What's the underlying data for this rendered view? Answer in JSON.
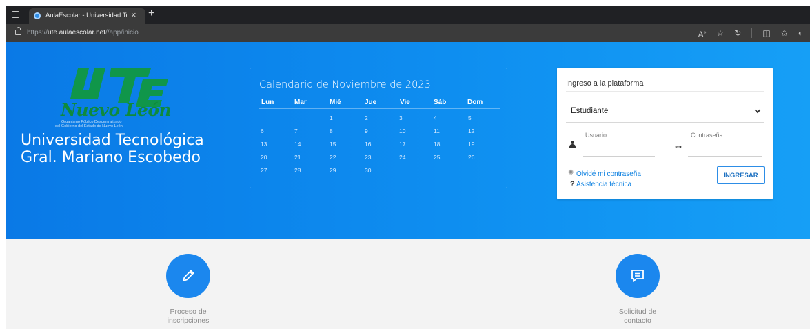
{
  "browser": {
    "tab_title": "AulaEscolar - Universidad Tecnológica",
    "tab_close": "×",
    "new_tab": "+",
    "url_prefix": "https://",
    "url_host": "ute.aulaescolar.net",
    "url_path": "//app/inicio",
    "icons": [
      "read-aloud-icon",
      "favorite-star-icon",
      "refresh-icon",
      "split-screen-icon",
      "favorites-icon",
      "copilot-icon"
    ]
  },
  "hero": {
    "logo_text": "Nuevo León",
    "logo_sub1": "Organismo Público Descentralizado",
    "logo_sub2": "del Gobierno del Estado de Nuevo León",
    "university_line1": "Universidad Tecnológica",
    "university_line2": "Gral. Mariano Escobedo",
    "gradient_start": "#0a79e6",
    "gradient_end": "#169ff6"
  },
  "calendar": {
    "title": "Calendario de Noviembre de 2023",
    "weekdays": [
      "Lun",
      "Mar",
      "Mié",
      "Jue",
      "Vie",
      "Sáb",
      "Dom"
    ],
    "weeks": [
      [
        "",
        "",
        "1",
        "2",
        "3",
        "4",
        "5"
      ],
      [
        "6",
        "7",
        "8",
        "9",
        "10",
        "11",
        "12"
      ],
      [
        "13",
        "14",
        "15",
        "16",
        "17",
        "18",
        "19"
      ],
      [
        "20",
        "21",
        "22",
        "23",
        "24",
        "25",
        "26"
      ],
      [
        "27",
        "28",
        "29",
        "30",
        "",
        "",
        ""
      ]
    ]
  },
  "login": {
    "title": "Ingreso a la plataforma",
    "role_value": "Estudiante",
    "user_label": "Usuario",
    "user_value": "",
    "password_label": "Contraseña",
    "password_value": "",
    "forgot_link": "Olvidé mi contraseña",
    "help_link": "Asistencia técnica",
    "submit_label": "INGRESAR",
    "accent": "#2d8de6"
  },
  "actions": [
    {
      "line1": "Proceso de",
      "line2": "inscripciones",
      "icon": "pencil-icon"
    },
    {
      "line1": "Solicitud de",
      "line2": "contacto",
      "icon": "message-icon"
    }
  ]
}
